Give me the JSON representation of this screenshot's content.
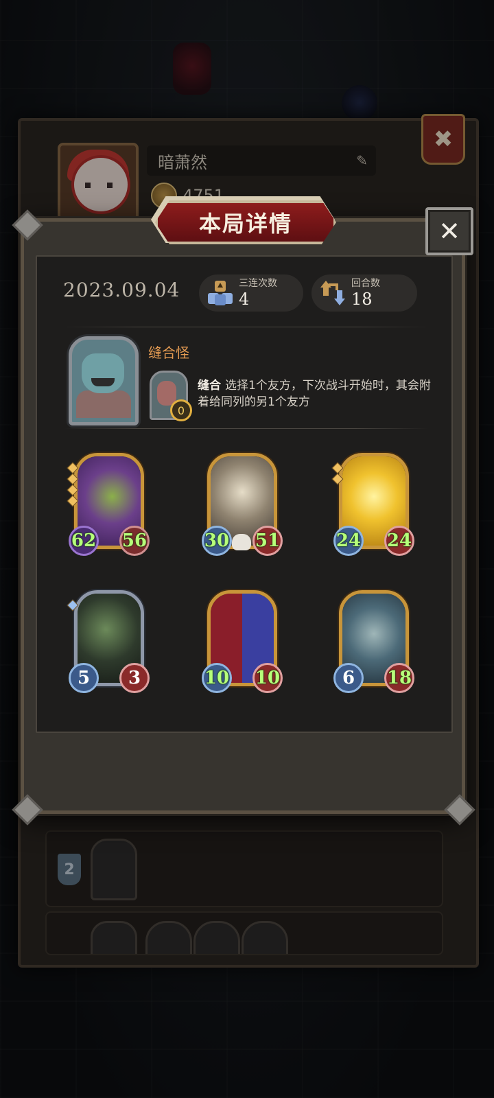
{
  "profile": {
    "player_name": "暗萧然",
    "coins": "4751"
  },
  "history": {
    "rows": [
      {
        "rank": "2"
      }
    ]
  },
  "modal": {
    "title": "本局详情",
    "date": "2023.09.04",
    "triple_label": "三连次数",
    "triple_value": "4",
    "rounds_label": "回合数",
    "rounds_value": "18"
  },
  "hero": {
    "name": "缝合怪",
    "skill_keyword": "缝合",
    "skill_text": "选择1个友方，下次战斗开始时，其会附着给同列的另1个友方",
    "skill_cost": "0"
  },
  "units": [
    {
      "name_icon": "purple-dragon",
      "attack": "62",
      "health": "56",
      "tier": "gold",
      "stars": 4,
      "boosted": true
    },
    {
      "name_icon": "bone-dragon",
      "attack": "30",
      "health": "51",
      "tier": "gold",
      "stars": 0,
      "boosted": true
    },
    {
      "name_icon": "golden-dragon",
      "attack": "24",
      "health": "24",
      "tier": "gold",
      "stars": 2,
      "boosted": true
    },
    {
      "name_icon": "hooded-reaper",
      "attack": "5",
      "health": "3",
      "tier": "silver",
      "stars": 1,
      "boosted": false
    },
    {
      "name_icon": "jester-clown",
      "attack": "10",
      "health": "10",
      "tier": "gold",
      "stars": 0,
      "boosted": true
    },
    {
      "name_icon": "armored-beast",
      "attack": "6",
      "health": "18",
      "tier": "gold",
      "stars": 0,
      "boosted": false
    }
  ],
  "colors": {
    "modal_bg": "#37342f",
    "banner_red": "#8d1c1c",
    "gold_frame": "#c8953a",
    "hero_name": "#e39a52",
    "boosted_stat": "#b6ff7a"
  }
}
